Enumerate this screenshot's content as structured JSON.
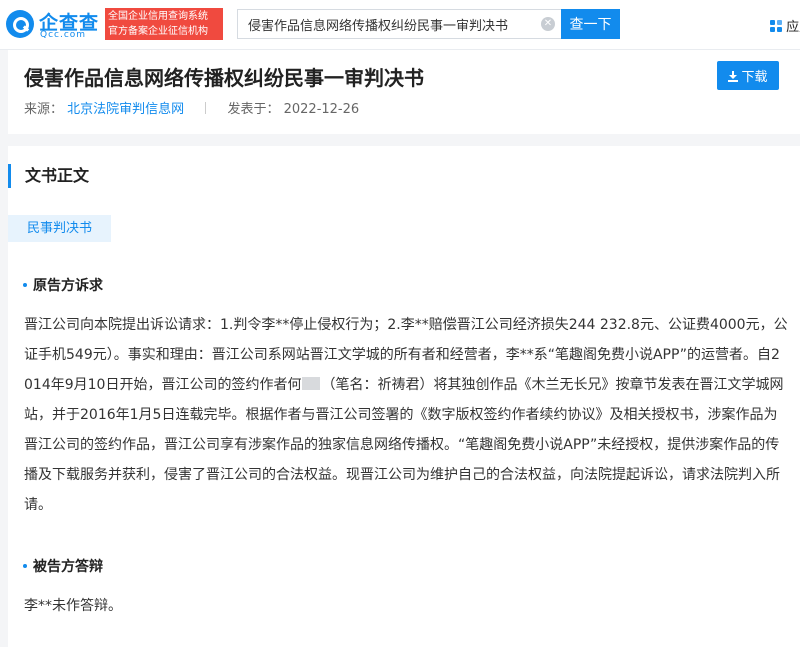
{
  "header": {
    "logo_name": "企查查",
    "logo_domain": "Qcc.com",
    "slogan_line1": "全国企业信用查询系统",
    "slogan_line2": "官方备案企业征信机构",
    "search_value": "侵害作品信息网络传播权纠纷民事一审判决书",
    "search_button": "查一下",
    "app_label": "应用"
  },
  "document": {
    "title": "侵害作品信息网络传播权纠纷民事一审判决书",
    "source_label": "来源：",
    "source_name": "北京法院审判信息网",
    "date_label": "发表于：",
    "date": "2022-12-26",
    "download_label": "下载"
  },
  "content": {
    "section_title": "文书正文",
    "doc_type": "民事判决书",
    "plaintiff_heading": "原告方诉求",
    "plaintiff_before_name": "晋江公司向本院提出诉讼请求：1.判令李**停止侵权行为；2.李**赔偿晋江公司经济损失244 232.8元、公证费4000元，公证手机549元）。事实和理由：晋江公司系网站晋江文学城的所有者和经营者，李**系“笔趣阁免费小说APP”的运营者。自2014年9月10日开始，晋江公司的签约作者何",
    "plaintiff_after_name": "（笔名：祈祷君）将其独创作品《木兰无长兄》按章节发表在晋江文学城网站，并于2016年1月5日连载完毕。根据作者与晋江公司签署的《数字版权签约作者续约协议》及相关授权书，涉案作品为晋江公司的签约作品，晋江公司享有涉案作品的独家信息网络传播权。“笔趣阁免费小说APP”未经授权，提供涉案作品的传播及下载服务并获利，侵害了晋江公司的合法权益。现晋江公司为维护自己的合法权益，向法院提起诉讼，请求法院判入所请。",
    "defendant_heading": "被告方答辩",
    "defendant_text": "李**未作答辩。"
  }
}
